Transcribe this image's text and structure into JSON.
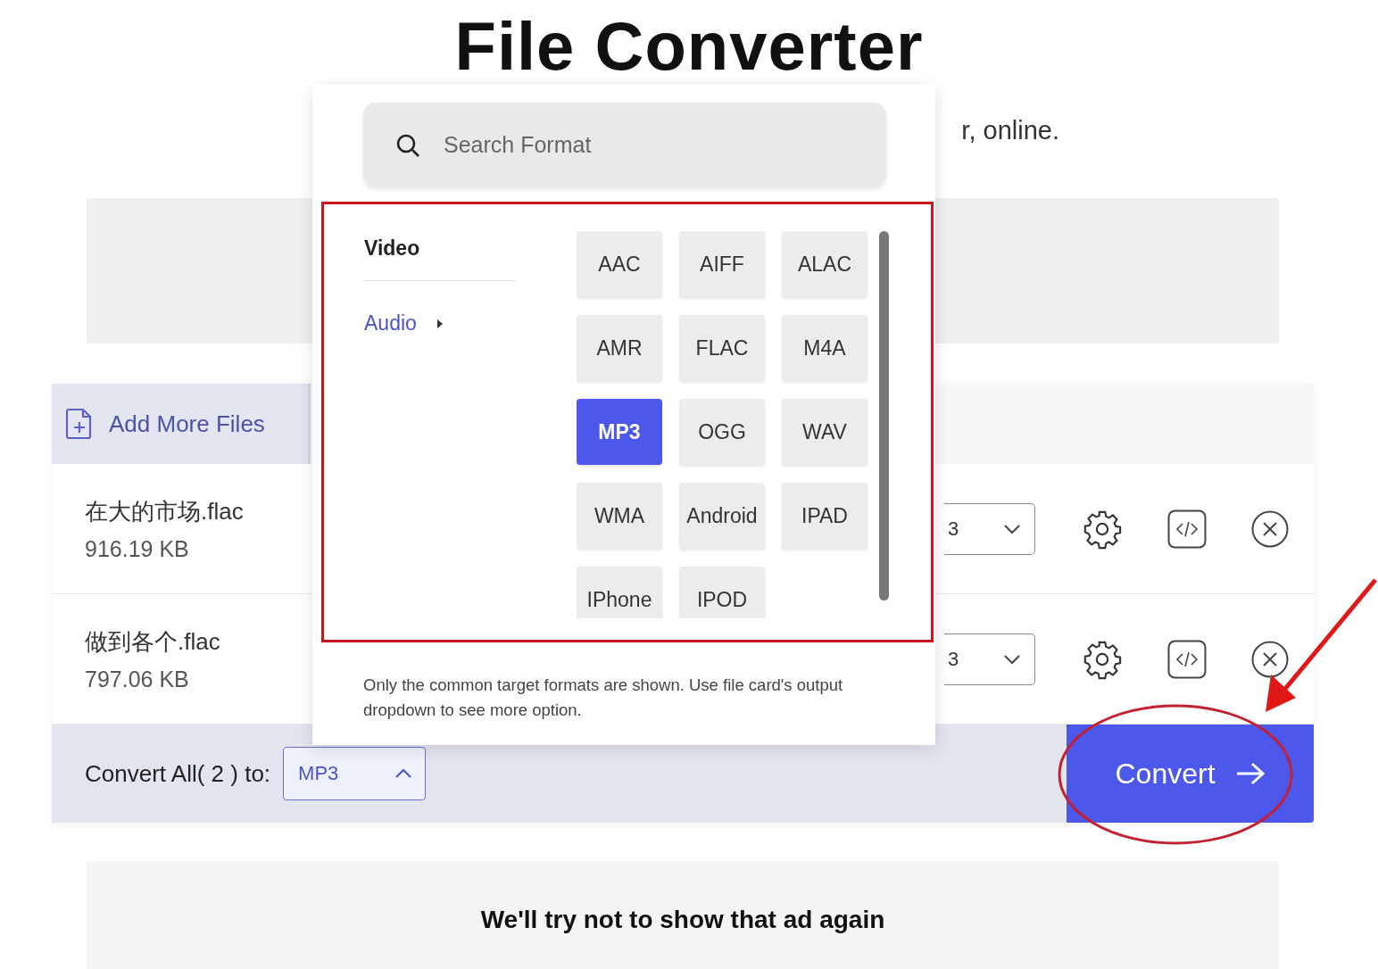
{
  "title": "File Converter",
  "subtitle": {
    "right": "r, online."
  },
  "upload_tab": {
    "label": "Add More Files"
  },
  "files": [
    {
      "name": "在大的市场.flac",
      "size": "916.19 KB",
      "format": "3"
    },
    {
      "name": "做到各个.flac",
      "size": "797.06 KB",
      "format": "3"
    }
  ],
  "convert_all": {
    "label": "Convert All( 2 ) to:",
    "format": "MP3"
  },
  "convert_button": {
    "label": "Convert"
  },
  "ad_notice": "We'll try not to show that ad again",
  "format_popup": {
    "search": {
      "placeholder": "Search Format"
    },
    "categories": [
      {
        "label": "Video",
        "selected": false
      },
      {
        "label": "Audio",
        "selected": true
      }
    ],
    "formats": [
      {
        "label": "AAC",
        "selected": false
      },
      {
        "label": "AIFF",
        "selected": false
      },
      {
        "label": "ALAC",
        "selected": false
      },
      {
        "label": "AMR",
        "selected": false
      },
      {
        "label": "FLAC",
        "selected": false
      },
      {
        "label": "M4A",
        "selected": false
      },
      {
        "label": "MP3",
        "selected": true
      },
      {
        "label": "OGG",
        "selected": false
      },
      {
        "label": "WAV",
        "selected": false
      },
      {
        "label": "WMA",
        "selected": false
      },
      {
        "label": "Android",
        "selected": false
      },
      {
        "label": "IPAD",
        "selected": false
      },
      {
        "label": "IPhone",
        "selected": false
      },
      {
        "label": "IPOD",
        "selected": false
      }
    ],
    "note": "Only the common target formats are shown. Use file card's output dropdown to see more option."
  }
}
